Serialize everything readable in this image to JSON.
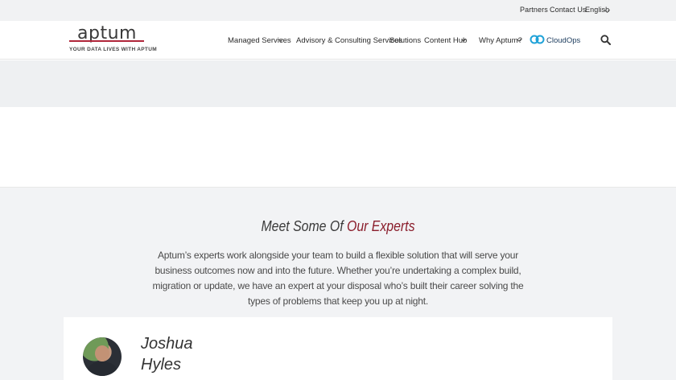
{
  "utility_bar": {
    "partners": "Partners",
    "contact": "Contact Us",
    "language": "English"
  },
  "brand": {
    "name": "aptum",
    "tagline": "YOUR DATA LIVES WITH APTUM",
    "accent_color": "#b0263a"
  },
  "nav": {
    "managed": "Managed Services",
    "advisory": "Advisory & Consulting Services",
    "solutions": "Solutions",
    "content": "Content Hub",
    "why": "Why Aptum?",
    "cloudops": "CloudOps"
  },
  "experts": {
    "title_plain": "Meet Some Of ",
    "title_accent": "Our Experts",
    "description": "Aptum’s experts work alongside your team to build a flexible solution that will serve your business outcomes now and into the future. Whether you’re undertaking a complex build, migration or update, we have an expert at your disposal who’s built their career solving the types of problems that keep you up at night.",
    "accent_color": "#8a1d2b"
  },
  "expert_card": {
    "first_name": "Joshua",
    "last_name": "Hyles"
  }
}
